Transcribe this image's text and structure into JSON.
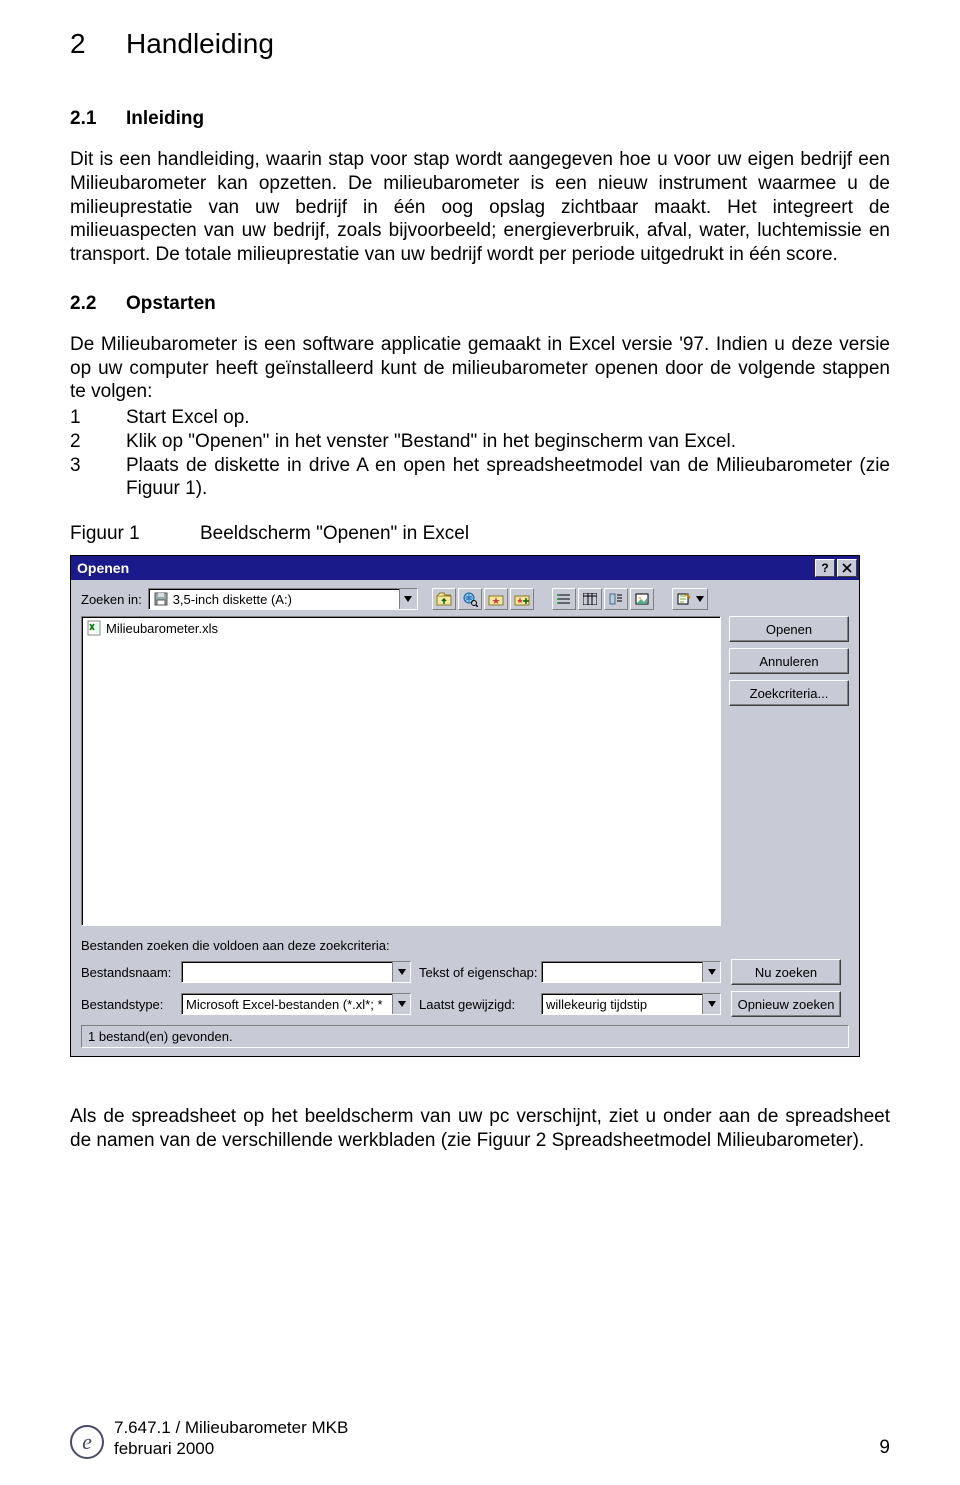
{
  "doc": {
    "h1_num": "2",
    "h1_title": "Handleiding",
    "s1_num": "2.1",
    "s1_title": "Inleiding",
    "p1": "Dit is een handleiding, waarin stap voor stap wordt aangegeven hoe u voor uw eigen bedrijf een Milieubarometer kan opzetten. De milieubarometer is een nieuw instrument waarmee u de milieuprestatie van uw bedrijf in één oog opslag zichtbaar maakt. Het integreert de milieuaspecten van uw bedrijf, zoals bijvoorbeeld; energieverbruik, afval, water, luchtemissie en transport. De totale milieuprestatie van uw bedrijf wordt per periode uitgedrukt in één score.",
    "s2_num": "2.2",
    "s2_title": "Opstarten",
    "p2": "De Milieubarometer is een software applicatie gemaakt in Excel versie '97. Indien u deze versie op uw computer heeft geïnstalleerd kunt de milieubarometer openen door de volgende stappen te volgen:",
    "steps": [
      {
        "n": "1",
        "t": "Start Excel op."
      },
      {
        "n": "2",
        "t": "Klik op \"Openen\" in het venster \"Bestand\" in het beginscherm van Excel."
      },
      {
        "n": "3",
        "t": "Plaats de diskette in drive A en open het spreadsheetmodel van de Milieubarometer (zie Figuur 1)."
      }
    ],
    "fig_label": "Figuur 1",
    "fig_caption": "Beeldscherm \"Openen\" in Excel",
    "p3": "Als de spreadsheet op het beeldscherm van uw pc verschijnt, ziet u onder aan de spreadsheet de namen van de verschillende werkbladen (zie Figuur 2   Spreadsheetmodel Milieubarometer).",
    "footer_line1": "7.647.1 / Milieubarometer MKB",
    "footer_line2": "februari 2000",
    "page_number": "9"
  },
  "dialog": {
    "title": "Openen",
    "look_in_label": "Zoeken in:",
    "look_in_value": "3,5-inch diskette (A:)",
    "file_item": "Milieubarometer.xls",
    "btn_open": "Openen",
    "btn_cancel": "Annuleren",
    "btn_advanced": "Zoekcriteria...",
    "criteria_label": "Bestanden zoeken die voldoen aan deze zoekcriteria:",
    "fname_label": "Bestandsnaam:",
    "fname_value": "",
    "ftype_label": "Bestandstype:",
    "ftype_value": "Microsoft Excel-bestanden (*.xl*; *",
    "prop_label": "Tekst of eigenschap:",
    "prop_value": "",
    "mod_label": "Laatst gewijzigd:",
    "mod_value": "willekeurig tijdstip",
    "btn_findnow": "Nu zoeken",
    "btn_newsearch": "Opnieuw zoeken",
    "status": "1 bestand(en) gevonden."
  }
}
